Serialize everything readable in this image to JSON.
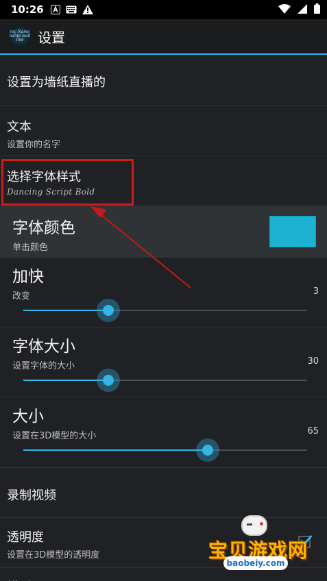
{
  "status_bar": {
    "time": "10:26",
    "icons": [
      "notification-a-icon",
      "keyboard-icon",
      "warning-icon",
      "wifi-icon",
      "signal-icon",
      "battery-icon"
    ]
  },
  "app_bar": {
    "title": "设置",
    "accent_color": "#33b5e5"
  },
  "settings": {
    "wallpaper": {
      "title": "设置为墙纸直播的"
    },
    "text": {
      "title": "文本",
      "summary": "设置你的名字"
    },
    "font_style": {
      "title": "选择字体样式",
      "summary": "Dancing Script Bold"
    },
    "font_color": {
      "title": "字体颜色",
      "summary": "单击颜色",
      "color": "#1eb1d1"
    },
    "speed": {
      "title": "加快",
      "summary": "改变",
      "value": "3",
      "fraction": 0.3
    },
    "font_size": {
      "title": "字体大小",
      "summary": "设置字体的大小",
      "value": "30",
      "fraction": 0.3
    },
    "size": {
      "title": "大小",
      "summary": "设置在3D模型的大小",
      "value": "65",
      "fraction": 0.65
    },
    "record_video": {
      "title": "录制视频"
    },
    "transparency": {
      "title": "透明度",
      "summary": "设置在3D模型的透明度",
      "checked": true
    },
    "model": {
      "title": "模型"
    }
  },
  "annotation": {
    "highlight_color": "#d11a1a"
  },
  "watermark": {
    "text": "宝贝游戏网",
    "url": "baobeiy.com"
  }
}
